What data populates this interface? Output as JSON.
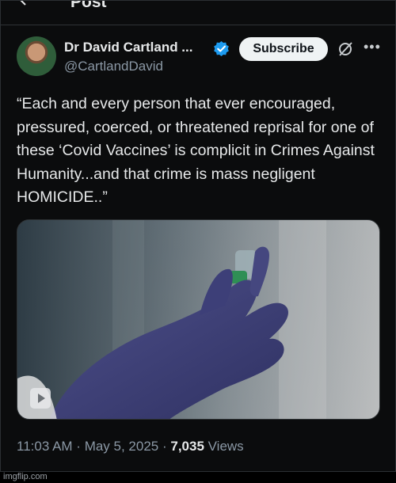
{
  "header": {
    "title": "Post",
    "back_icon": "arrow-left-icon"
  },
  "author": {
    "name": "Dr David Cartland ...",
    "handle": "@CartlandDavid",
    "verified_icon": "verified-badge-icon",
    "verified_color": "#1d9bf0"
  },
  "actions": {
    "subscribe_label": "Subscribe",
    "grok_icon": "grok-icon",
    "more_icon": "more-horizontal-icon"
  },
  "post": {
    "text": "“Each and every person that ever encouraged, pressured, coerced, or threatened reprisal for one of these ‘Covid Vaccines’ is complicit in Crimes Against Humanity...and that crime is mass negligent HOMICIDE..”",
    "media_icon": "play-icon"
  },
  "meta": {
    "time": "11:03 AM",
    "sep1": " · ",
    "date": "May 5, 2025",
    "sep2": " · ",
    "views_count": "7,035",
    "views_label": " Views"
  },
  "watermark": "imgflip.com"
}
